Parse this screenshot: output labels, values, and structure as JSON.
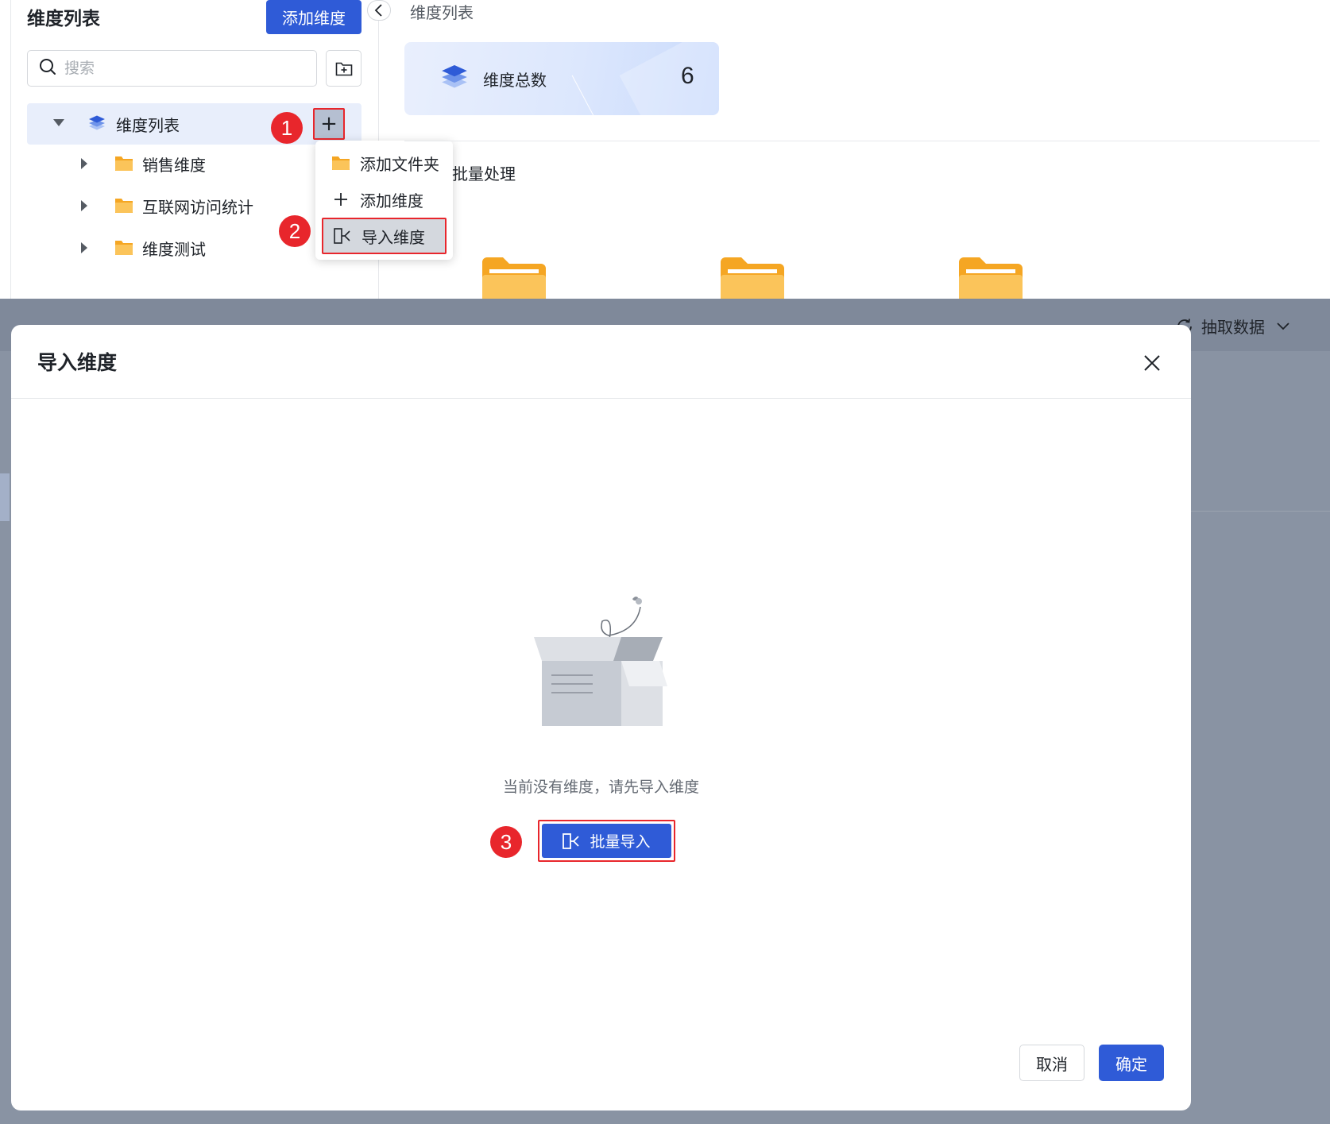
{
  "sidebar": {
    "title": "维度列表",
    "add_button": "添加维度",
    "search_placeholder": "搜索",
    "tree_root": "维度列表",
    "tree_items": [
      {
        "label": "销售维度",
        "icon": "folder-icon"
      },
      {
        "label": "互联网访问统计",
        "icon": "folder-icon"
      },
      {
        "label": "维度测试",
        "icon": "folder-icon"
      }
    ]
  },
  "dropdown": {
    "items": [
      {
        "label": "添加文件夹",
        "icon": "folder-icon"
      },
      {
        "label": "添加维度",
        "icon": "plus-icon"
      },
      {
        "label": "导入维度",
        "icon": "import-icon"
      }
    ]
  },
  "main": {
    "title": "维度列表",
    "stat_label": "维度总数",
    "stat_count": "6",
    "batch_label": "批量处理"
  },
  "overlay": {
    "extract_label": "抽取数据"
  },
  "modal": {
    "title": "导入维度",
    "empty_text": "当前没有维度，请先导入维度",
    "batch_import": "批量导入",
    "cancel": "取消",
    "confirm": "确定"
  },
  "annotations": {
    "step1": "1",
    "step2": "2",
    "step3": "3"
  },
  "colors": {
    "primary": "#2f5bd7",
    "highlight_border": "#e8262c",
    "folder": "#f5a623",
    "overlay": "#8993a3"
  }
}
